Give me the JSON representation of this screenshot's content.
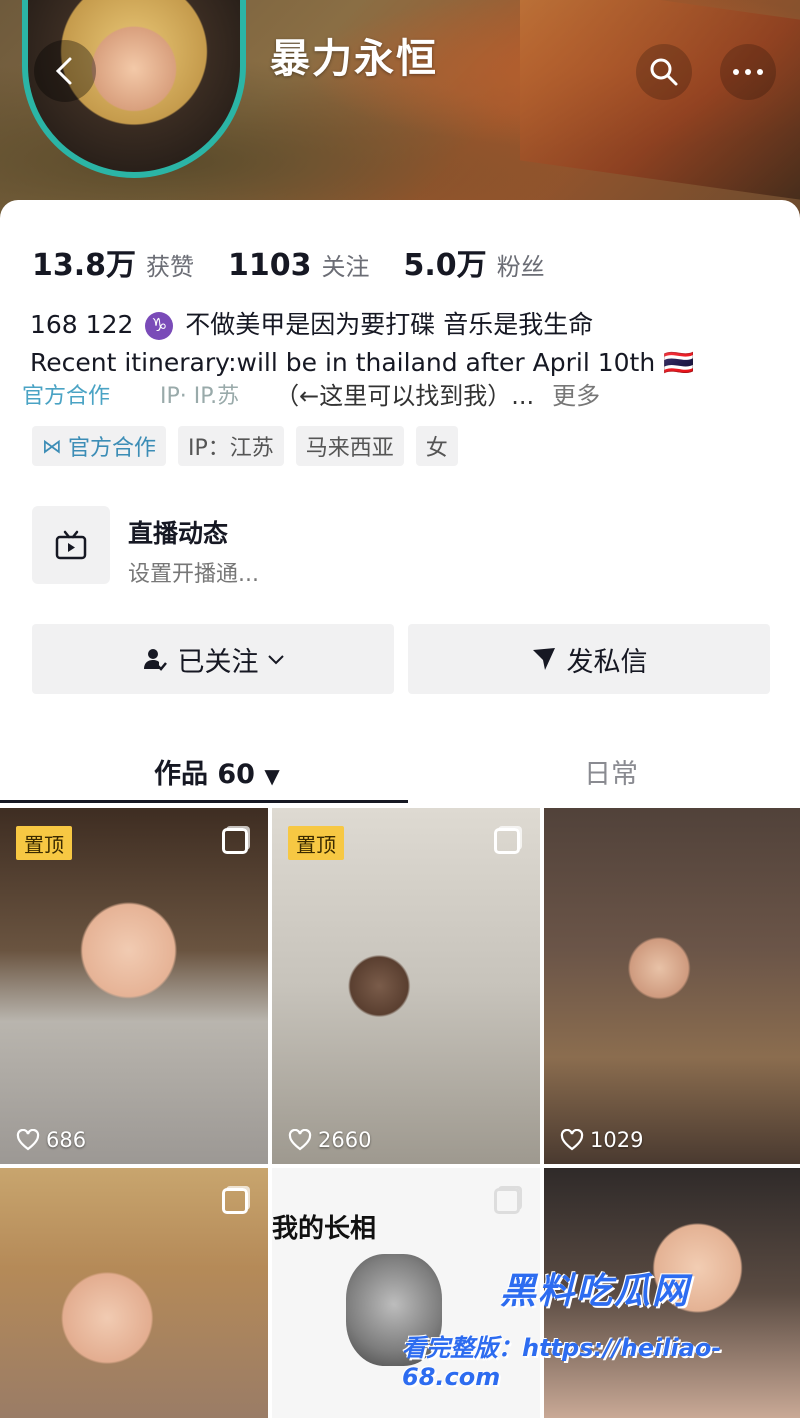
{
  "header": {
    "username": "暴力永恒",
    "back_icon": "chevron-left-icon",
    "search_icon": "search-icon",
    "more_icon": "more-icon"
  },
  "stats": [
    {
      "value": "13.8万",
      "label": "获赞"
    },
    {
      "value": "1103",
      "label": "关注"
    },
    {
      "value": "5.0万",
      "label": "粉丝"
    }
  ],
  "bio": {
    "line1": "168 122",
    "zodiac": "♑",
    "line1_text": "不做美甲是因为要打碟 音乐是我生命",
    "line2": "Recent itinerary:will be in thailand after April 10th 🇹🇭",
    "line3_official": "官方合作",
    "line3_ip": "IP· IP.苏",
    "line3_find": "（←这里可以找到我）...",
    "more": "更多"
  },
  "tags": [
    {
      "label": "官方合作",
      "icon": "handshake-icon"
    },
    {
      "label": "IP：江苏"
    },
    {
      "label": "马来西亚"
    },
    {
      "label": "女"
    }
  ],
  "live": {
    "title": "直播动态",
    "subtitle": "设置开播通..."
  },
  "actions": {
    "follow_label": "已关注",
    "message_label": "发私信"
  },
  "tabs": {
    "works": "作品 60",
    "works_arrow": "▼",
    "daily": "日常"
  },
  "posts": [
    {
      "pinned": "置顶",
      "likes": "686",
      "multi": true
    },
    {
      "pinned": "置顶",
      "likes": "2660",
      "multi": true
    },
    {
      "likes": "1029"
    },
    {
      "multi": true
    },
    {
      "caption": "我的长相",
      "multi": true
    },
    {}
  ],
  "watermark": {
    "brand": "黑料吃瓜网",
    "url_line": "看完整版：https://heiliao-68.com"
  },
  "colors": {
    "avatar_ring": "#2bb5a6",
    "pin_badge": "#f7c843",
    "official": "#3c8db6"
  }
}
